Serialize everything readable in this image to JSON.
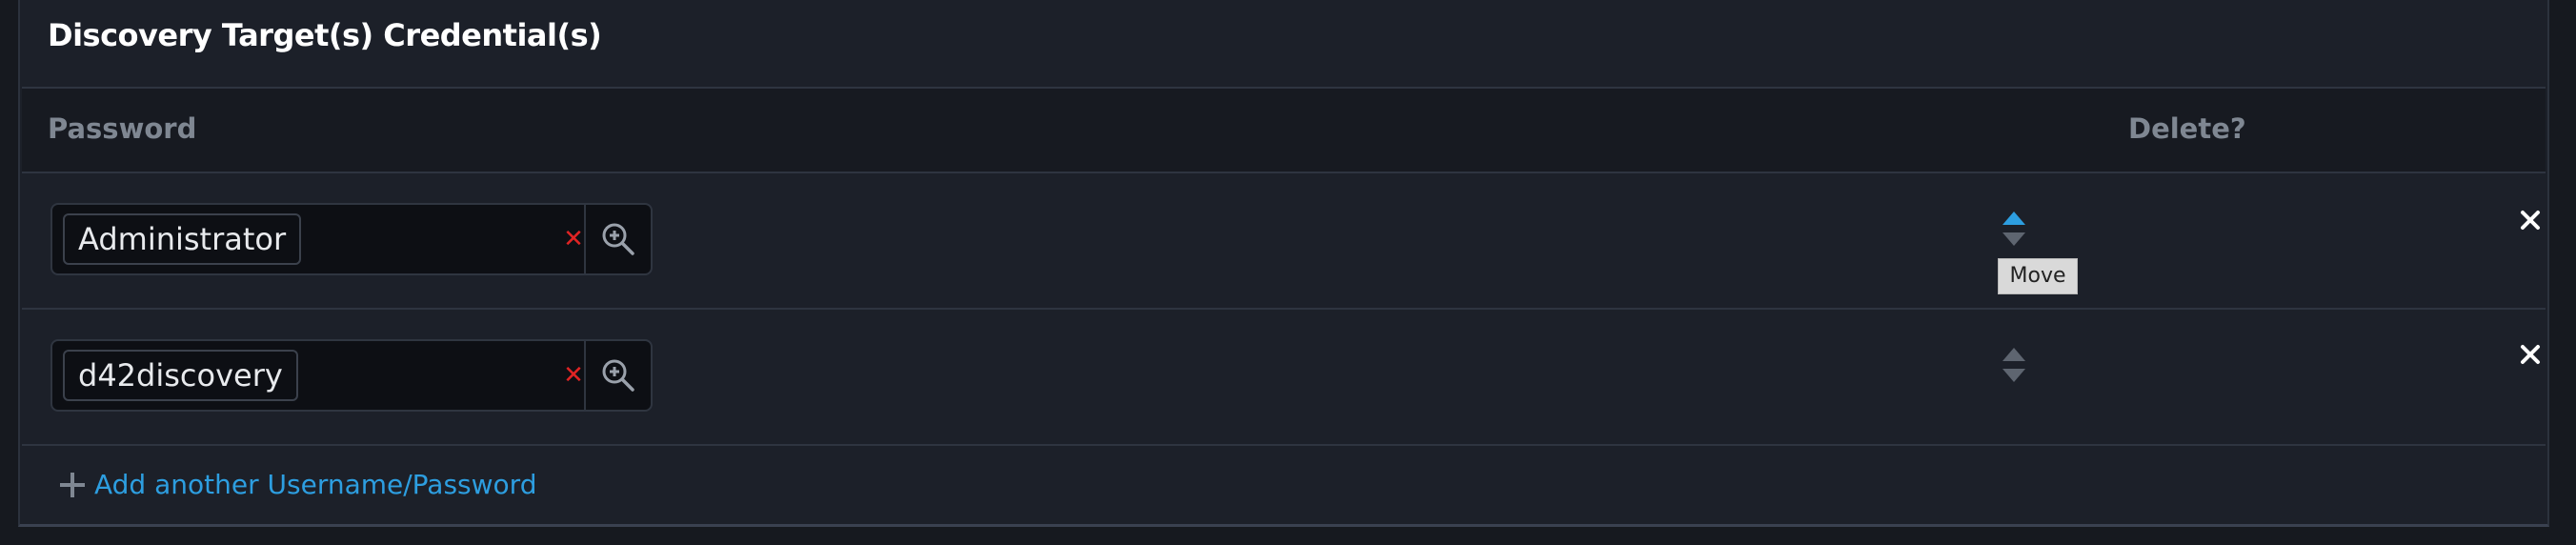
{
  "section": {
    "title": "Discovery Target(s) Credential(s)"
  },
  "table": {
    "columns": {
      "password": "Password",
      "delete": "Delete?"
    },
    "rows": [
      {
        "value": "Administrator"
      },
      {
        "value": "d42discovery"
      }
    ]
  },
  "tooltip": {
    "move": "Move"
  },
  "add": {
    "label": "Add another Username/Password"
  },
  "colors": {
    "accent": "#2d9ee0",
    "clear": "#e02424",
    "background": "#1c2029"
  },
  "icons": {
    "clear": "close-icon",
    "lookup": "magnifier-plus-icon",
    "move": "sort-arrows-icon",
    "delete": "close-icon",
    "add": "plus-icon"
  }
}
